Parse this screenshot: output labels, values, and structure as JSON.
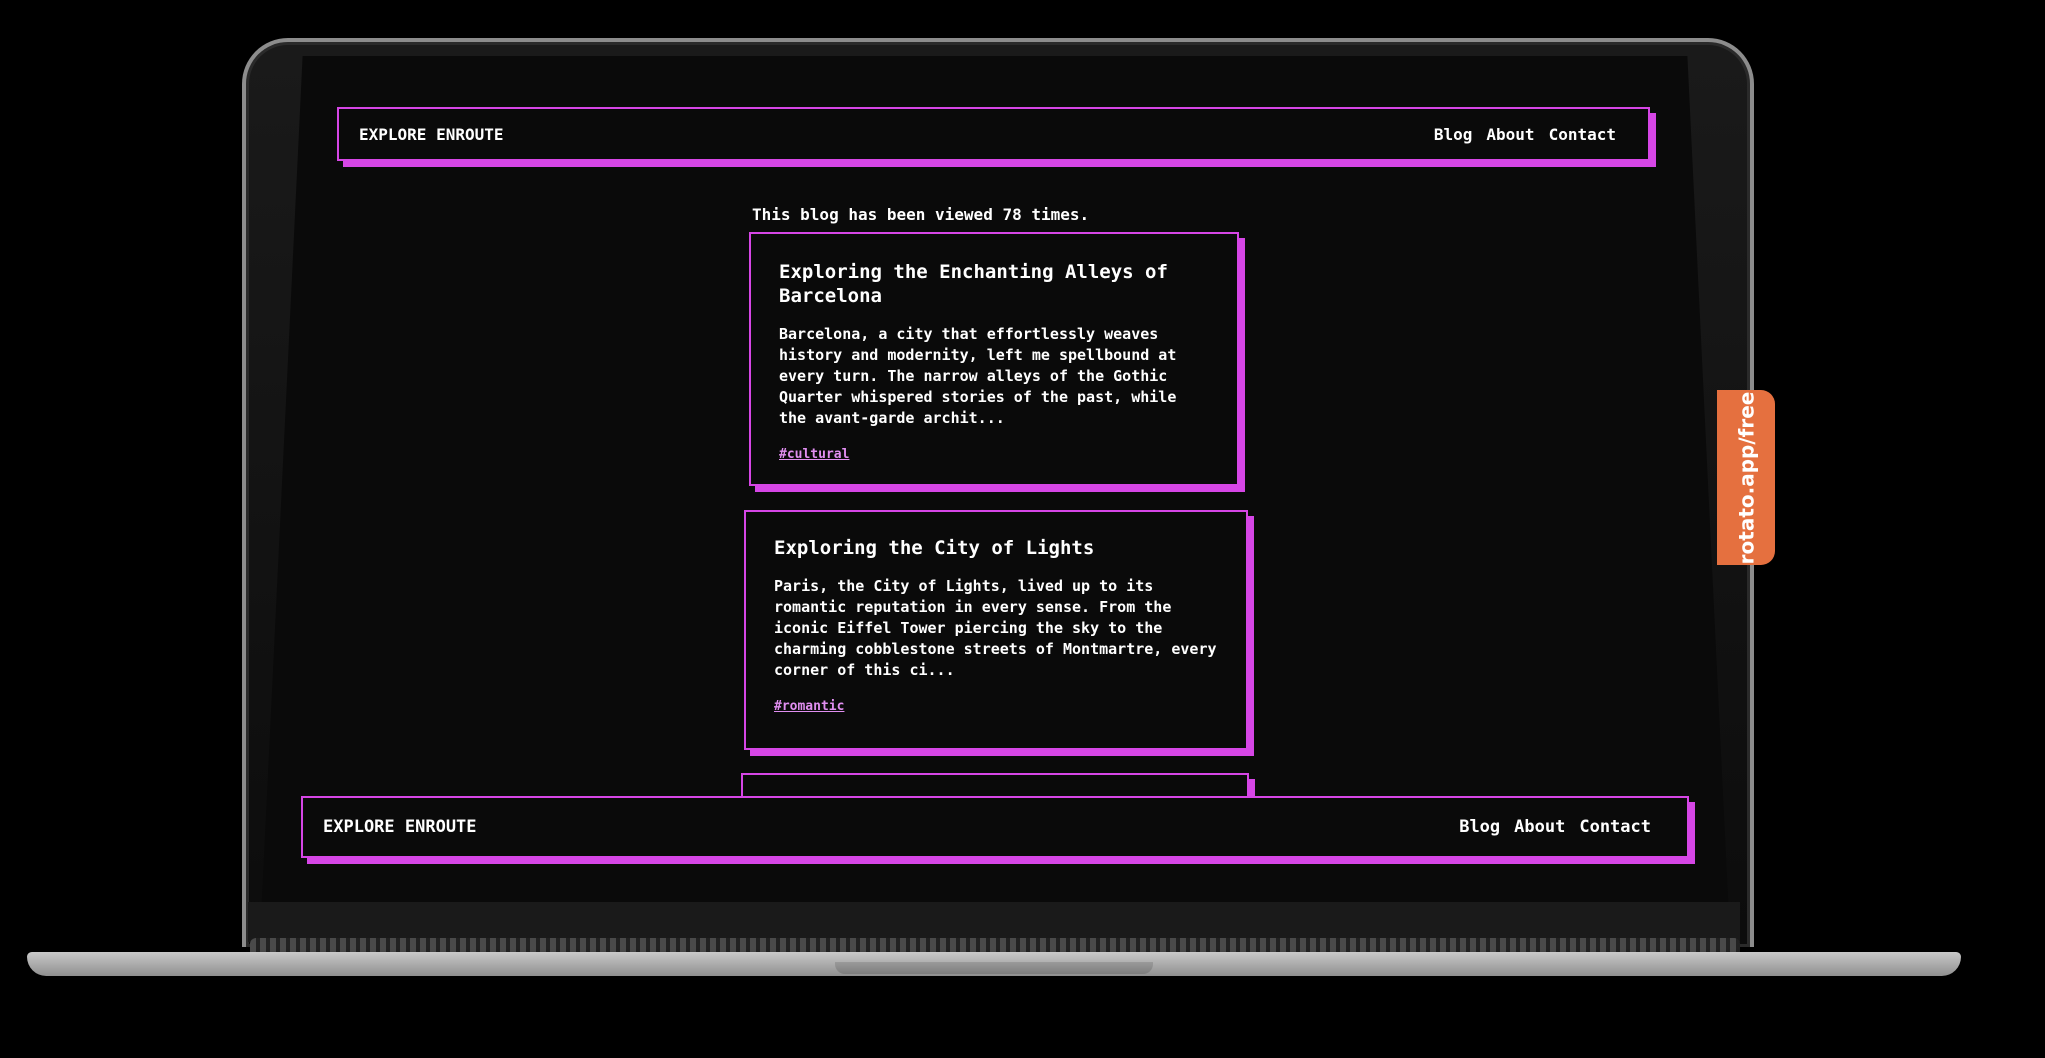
{
  "brand": "EXPLORE ENROUTE",
  "nav": [
    "Blog",
    "About",
    "Contact"
  ],
  "view_counter": "This blog has been viewed 78 times.",
  "posts": [
    {
      "title": "Exploring the Enchanting Alleys of Barcelona",
      "excerpt": "Barcelona, a city that effortlessly weaves history and modernity, left me spellbound at every turn. The narrow alleys of the Gothic Quarter whispered stories of the past, while the avant-garde archit...",
      "tag": "#cultural"
    },
    {
      "title": "Exploring the City of Lights",
      "excerpt": "Paris, the City of Lights, lived up to its romantic reputation in every sense. From the iconic Eiffel Tower piercing the sky to the charming cobblestone streets of Montmartre, every corner of this ci...",
      "tag": "#romantic"
    }
  ],
  "footer": {
    "brand": "EXPLORE ENROUTE",
    "nav": [
      "Blog",
      "About",
      "Contact"
    ]
  },
  "mockup_badge": "rotato.app/free",
  "colors": {
    "accent": "#d646e6",
    "background": "#0a0a0a",
    "badge": "#e5703f"
  }
}
